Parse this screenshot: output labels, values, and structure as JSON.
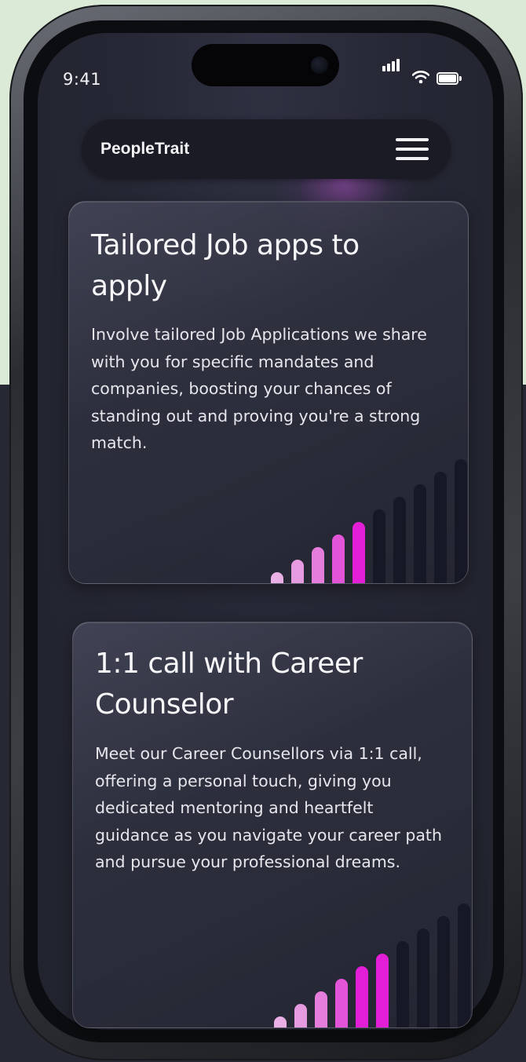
{
  "status": {
    "time": "9:41"
  },
  "navbar": {
    "brand": "PeopleTrait",
    "menu_icon": "hamburger-menu-icon"
  },
  "cards": [
    {
      "title": "Tailored Job apps to apply",
      "body": "Involve tailored Job Applications we share with you for specific mandates and companies, boosting your chances of standing out and proving you're a strong match."
    },
    {
      "title": "1:1 call with Career Counselor",
      "body": "Meet our Career Counsellors via 1:1 call, offering a personal touch, giving you dedicated mentoring and heartfelt guidance as you navigate your career path and pursue your professional dreams."
    }
  ],
  "colors": {
    "accent": "#e21fd6",
    "bar_light": "#e9a0e3",
    "bar_dark": "#161825",
    "screen_bg": "#252734"
  }
}
